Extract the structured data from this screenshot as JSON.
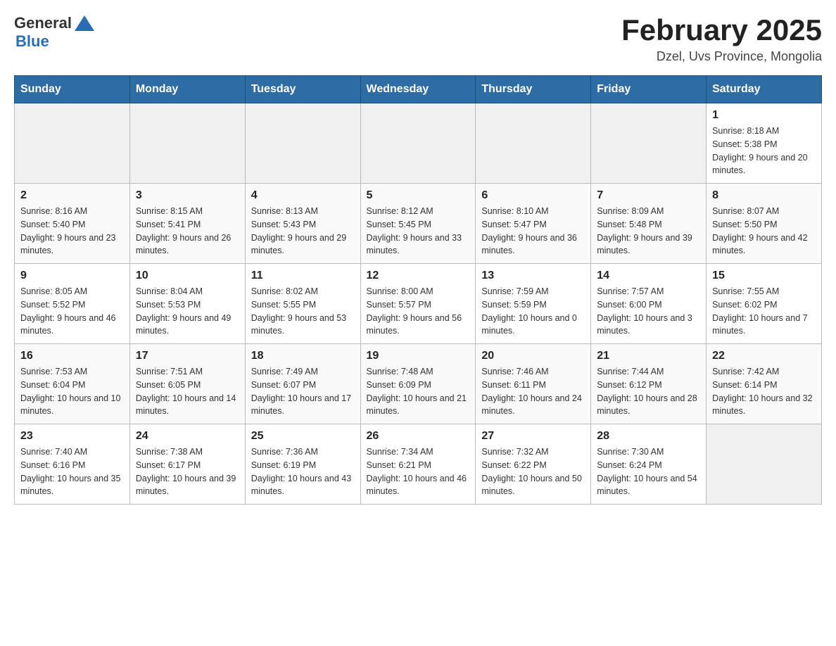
{
  "header": {
    "logo_general": "General",
    "logo_blue": "Blue",
    "title": "February 2025",
    "subtitle": "Dzel, Uvs Province, Mongolia"
  },
  "weekdays": [
    "Sunday",
    "Monday",
    "Tuesday",
    "Wednesday",
    "Thursday",
    "Friday",
    "Saturday"
  ],
  "weeks": [
    {
      "days": [
        {
          "number": "",
          "info": ""
        },
        {
          "number": "",
          "info": ""
        },
        {
          "number": "",
          "info": ""
        },
        {
          "number": "",
          "info": ""
        },
        {
          "number": "",
          "info": ""
        },
        {
          "number": "",
          "info": ""
        },
        {
          "number": "1",
          "info": "Sunrise: 8:18 AM\nSunset: 5:38 PM\nDaylight: 9 hours and 20 minutes."
        }
      ]
    },
    {
      "days": [
        {
          "number": "2",
          "info": "Sunrise: 8:16 AM\nSunset: 5:40 PM\nDaylight: 9 hours and 23 minutes."
        },
        {
          "number": "3",
          "info": "Sunrise: 8:15 AM\nSunset: 5:41 PM\nDaylight: 9 hours and 26 minutes."
        },
        {
          "number": "4",
          "info": "Sunrise: 8:13 AM\nSunset: 5:43 PM\nDaylight: 9 hours and 29 minutes."
        },
        {
          "number": "5",
          "info": "Sunrise: 8:12 AM\nSunset: 5:45 PM\nDaylight: 9 hours and 33 minutes."
        },
        {
          "number": "6",
          "info": "Sunrise: 8:10 AM\nSunset: 5:47 PM\nDaylight: 9 hours and 36 minutes."
        },
        {
          "number": "7",
          "info": "Sunrise: 8:09 AM\nSunset: 5:48 PM\nDaylight: 9 hours and 39 minutes."
        },
        {
          "number": "8",
          "info": "Sunrise: 8:07 AM\nSunset: 5:50 PM\nDaylight: 9 hours and 42 minutes."
        }
      ]
    },
    {
      "days": [
        {
          "number": "9",
          "info": "Sunrise: 8:05 AM\nSunset: 5:52 PM\nDaylight: 9 hours and 46 minutes."
        },
        {
          "number": "10",
          "info": "Sunrise: 8:04 AM\nSunset: 5:53 PM\nDaylight: 9 hours and 49 minutes."
        },
        {
          "number": "11",
          "info": "Sunrise: 8:02 AM\nSunset: 5:55 PM\nDaylight: 9 hours and 53 minutes."
        },
        {
          "number": "12",
          "info": "Sunrise: 8:00 AM\nSunset: 5:57 PM\nDaylight: 9 hours and 56 minutes."
        },
        {
          "number": "13",
          "info": "Sunrise: 7:59 AM\nSunset: 5:59 PM\nDaylight: 10 hours and 0 minutes."
        },
        {
          "number": "14",
          "info": "Sunrise: 7:57 AM\nSunset: 6:00 PM\nDaylight: 10 hours and 3 minutes."
        },
        {
          "number": "15",
          "info": "Sunrise: 7:55 AM\nSunset: 6:02 PM\nDaylight: 10 hours and 7 minutes."
        }
      ]
    },
    {
      "days": [
        {
          "number": "16",
          "info": "Sunrise: 7:53 AM\nSunset: 6:04 PM\nDaylight: 10 hours and 10 minutes."
        },
        {
          "number": "17",
          "info": "Sunrise: 7:51 AM\nSunset: 6:05 PM\nDaylight: 10 hours and 14 minutes."
        },
        {
          "number": "18",
          "info": "Sunrise: 7:49 AM\nSunset: 6:07 PM\nDaylight: 10 hours and 17 minutes."
        },
        {
          "number": "19",
          "info": "Sunrise: 7:48 AM\nSunset: 6:09 PM\nDaylight: 10 hours and 21 minutes."
        },
        {
          "number": "20",
          "info": "Sunrise: 7:46 AM\nSunset: 6:11 PM\nDaylight: 10 hours and 24 minutes."
        },
        {
          "number": "21",
          "info": "Sunrise: 7:44 AM\nSunset: 6:12 PM\nDaylight: 10 hours and 28 minutes."
        },
        {
          "number": "22",
          "info": "Sunrise: 7:42 AM\nSunset: 6:14 PM\nDaylight: 10 hours and 32 minutes."
        }
      ]
    },
    {
      "days": [
        {
          "number": "23",
          "info": "Sunrise: 7:40 AM\nSunset: 6:16 PM\nDaylight: 10 hours and 35 minutes."
        },
        {
          "number": "24",
          "info": "Sunrise: 7:38 AM\nSunset: 6:17 PM\nDaylight: 10 hours and 39 minutes."
        },
        {
          "number": "25",
          "info": "Sunrise: 7:36 AM\nSunset: 6:19 PM\nDaylight: 10 hours and 43 minutes."
        },
        {
          "number": "26",
          "info": "Sunrise: 7:34 AM\nSunset: 6:21 PM\nDaylight: 10 hours and 46 minutes."
        },
        {
          "number": "27",
          "info": "Sunrise: 7:32 AM\nSunset: 6:22 PM\nDaylight: 10 hours and 50 minutes."
        },
        {
          "number": "28",
          "info": "Sunrise: 7:30 AM\nSunset: 6:24 PM\nDaylight: 10 hours and 54 minutes."
        },
        {
          "number": "",
          "info": ""
        }
      ]
    }
  ]
}
